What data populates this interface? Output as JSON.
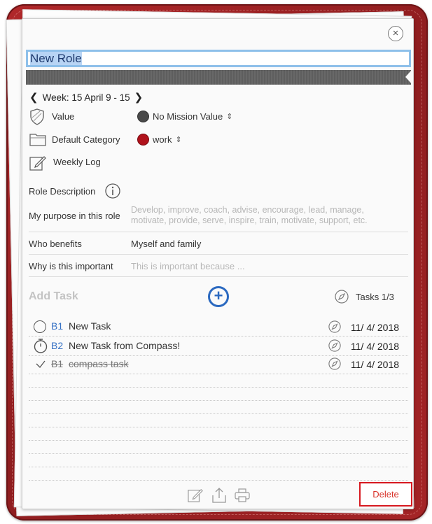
{
  "role": {
    "title": "New Role"
  },
  "week": {
    "label": "Week: 15 April 9 - 15"
  },
  "fields": {
    "value_label": "Value",
    "value_selected": "No Mission Value",
    "value_color": "#4a4a4a",
    "category_label": "Default Category",
    "category_selected": "work",
    "category_color": "#b0121b",
    "weekly_log_label": "Weekly Log"
  },
  "description": {
    "heading": "Role Description",
    "purpose_label": "My purpose in this role",
    "purpose_placeholder_line1": "Develop, improve, coach, advise, encourage, lead, manage,",
    "purpose_placeholder_line2": "motivate, provide, serve, inspire, train, motivate, support, etc.",
    "benefits_label": "Who benefits",
    "benefits_value": "Myself and family",
    "important_label": "Why is this important",
    "important_placeholder": "This is important because ..."
  },
  "tasks": {
    "add_label": "Add Task",
    "count_label": "Tasks 1/3",
    "items": [
      {
        "priority": "B1",
        "name": "New Task",
        "date": "11/ 4/ 2018",
        "status": "open"
      },
      {
        "priority": "B2",
        "name": "New Task from Compass!",
        "date": "11/ 4/ 2018",
        "status": "timed"
      },
      {
        "priority": "B1",
        "name": "compass task",
        "date": "11/ 4/ 2018",
        "status": "done"
      }
    ]
  },
  "footer": {
    "delete_label": "Delete"
  },
  "icons": {
    "close": "close-icon",
    "prev": "chevron-left-icon",
    "next": "chevron-right-icon",
    "value": "shield-icon",
    "category": "folder-icon",
    "log": "edit-icon",
    "info": "info-icon",
    "add": "plus-circle-icon",
    "compass": "compass-icon",
    "share": "share-icon",
    "print": "printer-icon"
  },
  "colors": {
    "accent": "#2b69c0",
    "frame": "#a52426",
    "delete": "#d71920"
  }
}
